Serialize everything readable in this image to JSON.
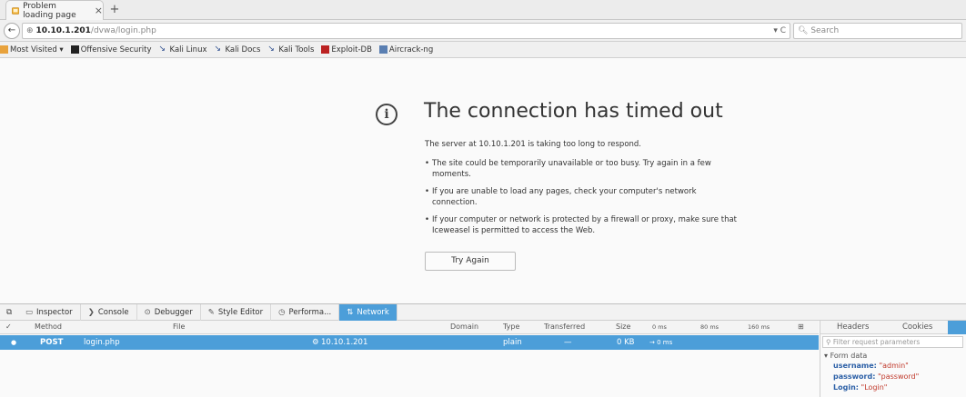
{
  "browser": {
    "tab_title": "Problem loading page",
    "tab_close": "×",
    "new_tab": "+",
    "url_host": "10.10.1.201",
    "url_path": "/dvwa/login.php",
    "url_controls": "▾ C",
    "search_placeholder": "Search"
  },
  "bookmarks": [
    "Most Visited ▾",
    "Offensive Security",
    "Kali Linux",
    "Kali Docs",
    "Kali Tools",
    "Exploit-DB",
    "Aircrack-ng"
  ],
  "error_page": {
    "title": "The connection has timed out",
    "description": "The server at 10.10.1.201 is taking too long to respond.",
    "bullets": [
      "The site could be temporarily unavailable or too busy. Try again in a few moments.",
      "If you are unable to load any pages, check your computer's network connection.",
      "If your computer or network is protected by a firewall or proxy, make sure that Iceweasel is permitted to access the Web."
    ],
    "retry_label": "Try Again"
  },
  "devtools": {
    "tabs": [
      "Inspector",
      "Console",
      "Debugger",
      "Style Editor",
      "Performa...",
      "Network"
    ],
    "network": {
      "columns": [
        "✓",
        "Method",
        "File",
        "Domain",
        "Type",
        "Transferred",
        "Size",
        "0 ms",
        "80 ms",
        "160 ms"
      ],
      "row": {
        "method": "POST",
        "file": "login.php",
        "domain": "10.10.1.201",
        "type": "plain",
        "transferred": "—",
        "size": "0 KB",
        "timing": "→ 0 ms"
      }
    },
    "side_tabs": [
      "Headers",
      "Cookies"
    ],
    "filter_placeholder": "Filter request parameters",
    "form_data_label": "Form data",
    "form_data": [
      {
        "key": "username:",
        "value": "\"admin\""
      },
      {
        "key": "password:",
        "value": "\"password\""
      },
      {
        "key": "Login:",
        "value": "\"Login\""
      }
    ]
  }
}
